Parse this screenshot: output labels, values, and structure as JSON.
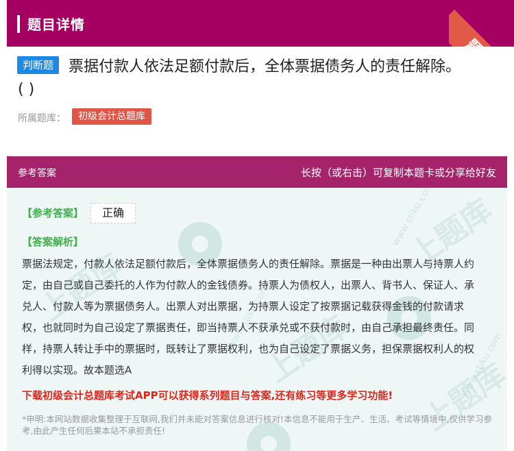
{
  "header": {
    "title": "题目详情",
    "ribbon": "题卡"
  },
  "question": {
    "type": "判断题",
    "text": "票据付款人依法足额付款后，全体票据债务人的责任解除。",
    "blank": "( )",
    "bank_label": "所属题库：",
    "bank_name": "初级会计总题库"
  },
  "answer_section": {
    "title": "参考答案",
    "hint": "长按（或右击）可复制本题卡或分享给好友",
    "ref_label": "【参考答案】",
    "ref_value": "正确",
    "analysis_label": "【答案解析】",
    "analysis": "票据法规定，付款人依法足额付款后，全体票据债务人的责任解除。票据是一种由出票人与持票人约定，由自己或自己委托的人作为付款人的金钱债券。持票人为债权人，出票人、背书人、保证人、承兑人、付款人等为票据债务人。出票人对出票据，为持票人设定了按票据记载获得金钱的付款请求权，也就同时为自己设定了票据责任，即当持票人不获承兑或不获付款时，由自己承担最终责任。同样，持票人转让手中的票据时，既转让了票据权利，也为自己设定了票据义务，担保票据权利人的权利得以实现。故本题选A",
    "promo": "下载初级会计总题库考试APP可以获得系列题目与答案,还有练习等更多学习功能!",
    "disclaimer": "*申明:本网站数据收集整理于互联网,我们并未能对答案信息进行核对!本信息不能用于生产、生活、考试等情境中,仅供学习参考,由此产生任何后果本站不承担责任!"
  },
  "watermark": {
    "brand": "上题库",
    "site": "www.stiku.com"
  },
  "colors": {
    "header_bg": "#a50061",
    "answer_header_bg": "#a5236b",
    "type_tag": "#1e88e5",
    "bank_tag": "#e05546",
    "label_green": "#3bb34a",
    "promo_red": "#e0261b"
  }
}
